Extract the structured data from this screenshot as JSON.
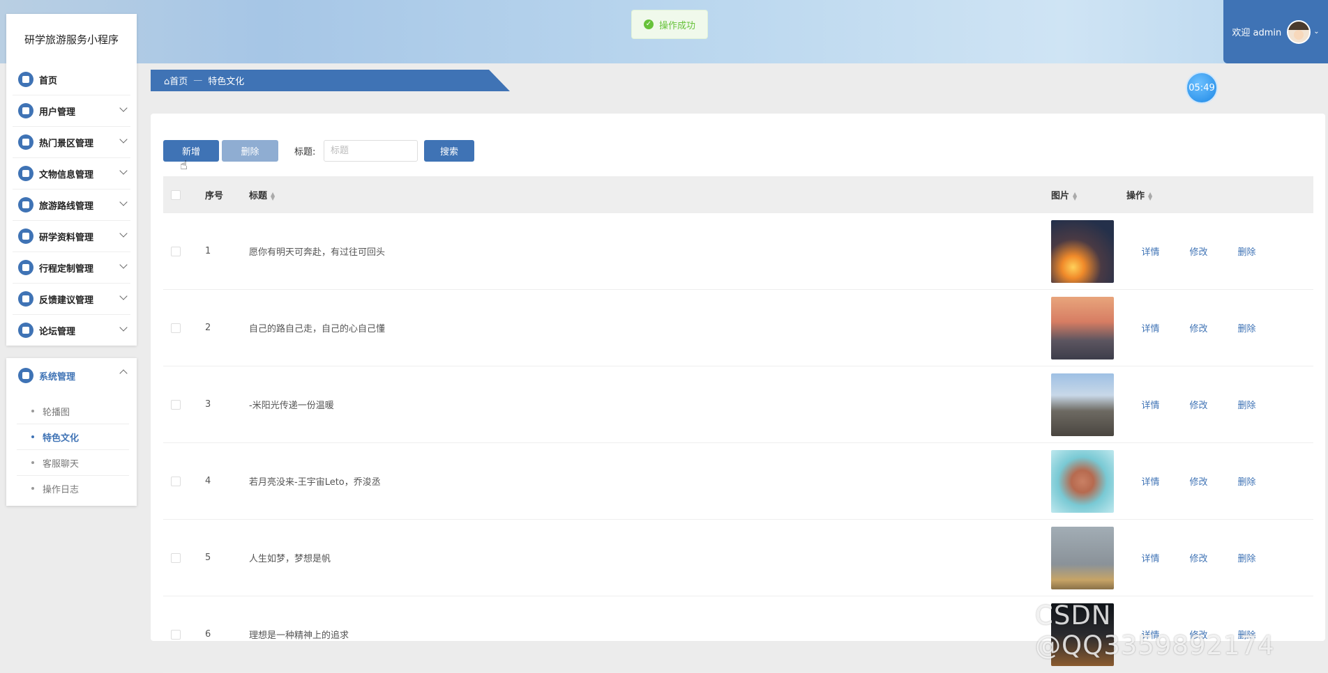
{
  "header": {
    "toast": "操作成功",
    "welcome": "欢迎 admin"
  },
  "sidebar": {
    "brand": "研学旅游服务小程序",
    "items": [
      {
        "label": "首页"
      },
      {
        "label": "用户管理"
      },
      {
        "label": "热门景区管理"
      },
      {
        "label": "文物信息管理"
      },
      {
        "label": "旅游路线管理"
      },
      {
        "label": "研学资料管理"
      },
      {
        "label": "行程定制管理"
      },
      {
        "label": "反馈建议管理"
      },
      {
        "label": "论坛管理"
      }
    ],
    "system": {
      "label": "系统管理",
      "subs": [
        {
          "label": "轮播图"
        },
        {
          "label": "特色文化"
        },
        {
          "label": "客服聊天"
        },
        {
          "label": "操作日志"
        }
      ]
    }
  },
  "breadcrumb": {
    "home": "首页",
    "sep": "—",
    "current": "特色文化"
  },
  "timer": "05:49",
  "toolbar": {
    "add": "新增",
    "delete": "删除",
    "title_label": "标题:",
    "title_placeholder": "标题",
    "search": "搜索"
  },
  "table": {
    "headers": {
      "no": "序号",
      "title": "标题",
      "image": "图片",
      "ops": "操作"
    },
    "ops": {
      "detail": "详情",
      "edit": "修改",
      "delete": "删除"
    },
    "rows": [
      {
        "no": "1",
        "title": "愿你有明天可奔赴，有过往可回头"
      },
      {
        "no": "2",
        "title": "自己的路自己走，自己的心自己懂"
      },
      {
        "no": "3",
        "title": "-米阳光传递一份温暖"
      },
      {
        "no": "4",
        "title": "若月亮没来-王宇宙Leto，乔浚丞"
      },
      {
        "no": "5",
        "title": "人生如梦，梦想是帆"
      },
      {
        "no": "6",
        "title": "理想是一种精神上的追求"
      }
    ]
  },
  "watermark": "CSDN @QQ3359892174"
}
